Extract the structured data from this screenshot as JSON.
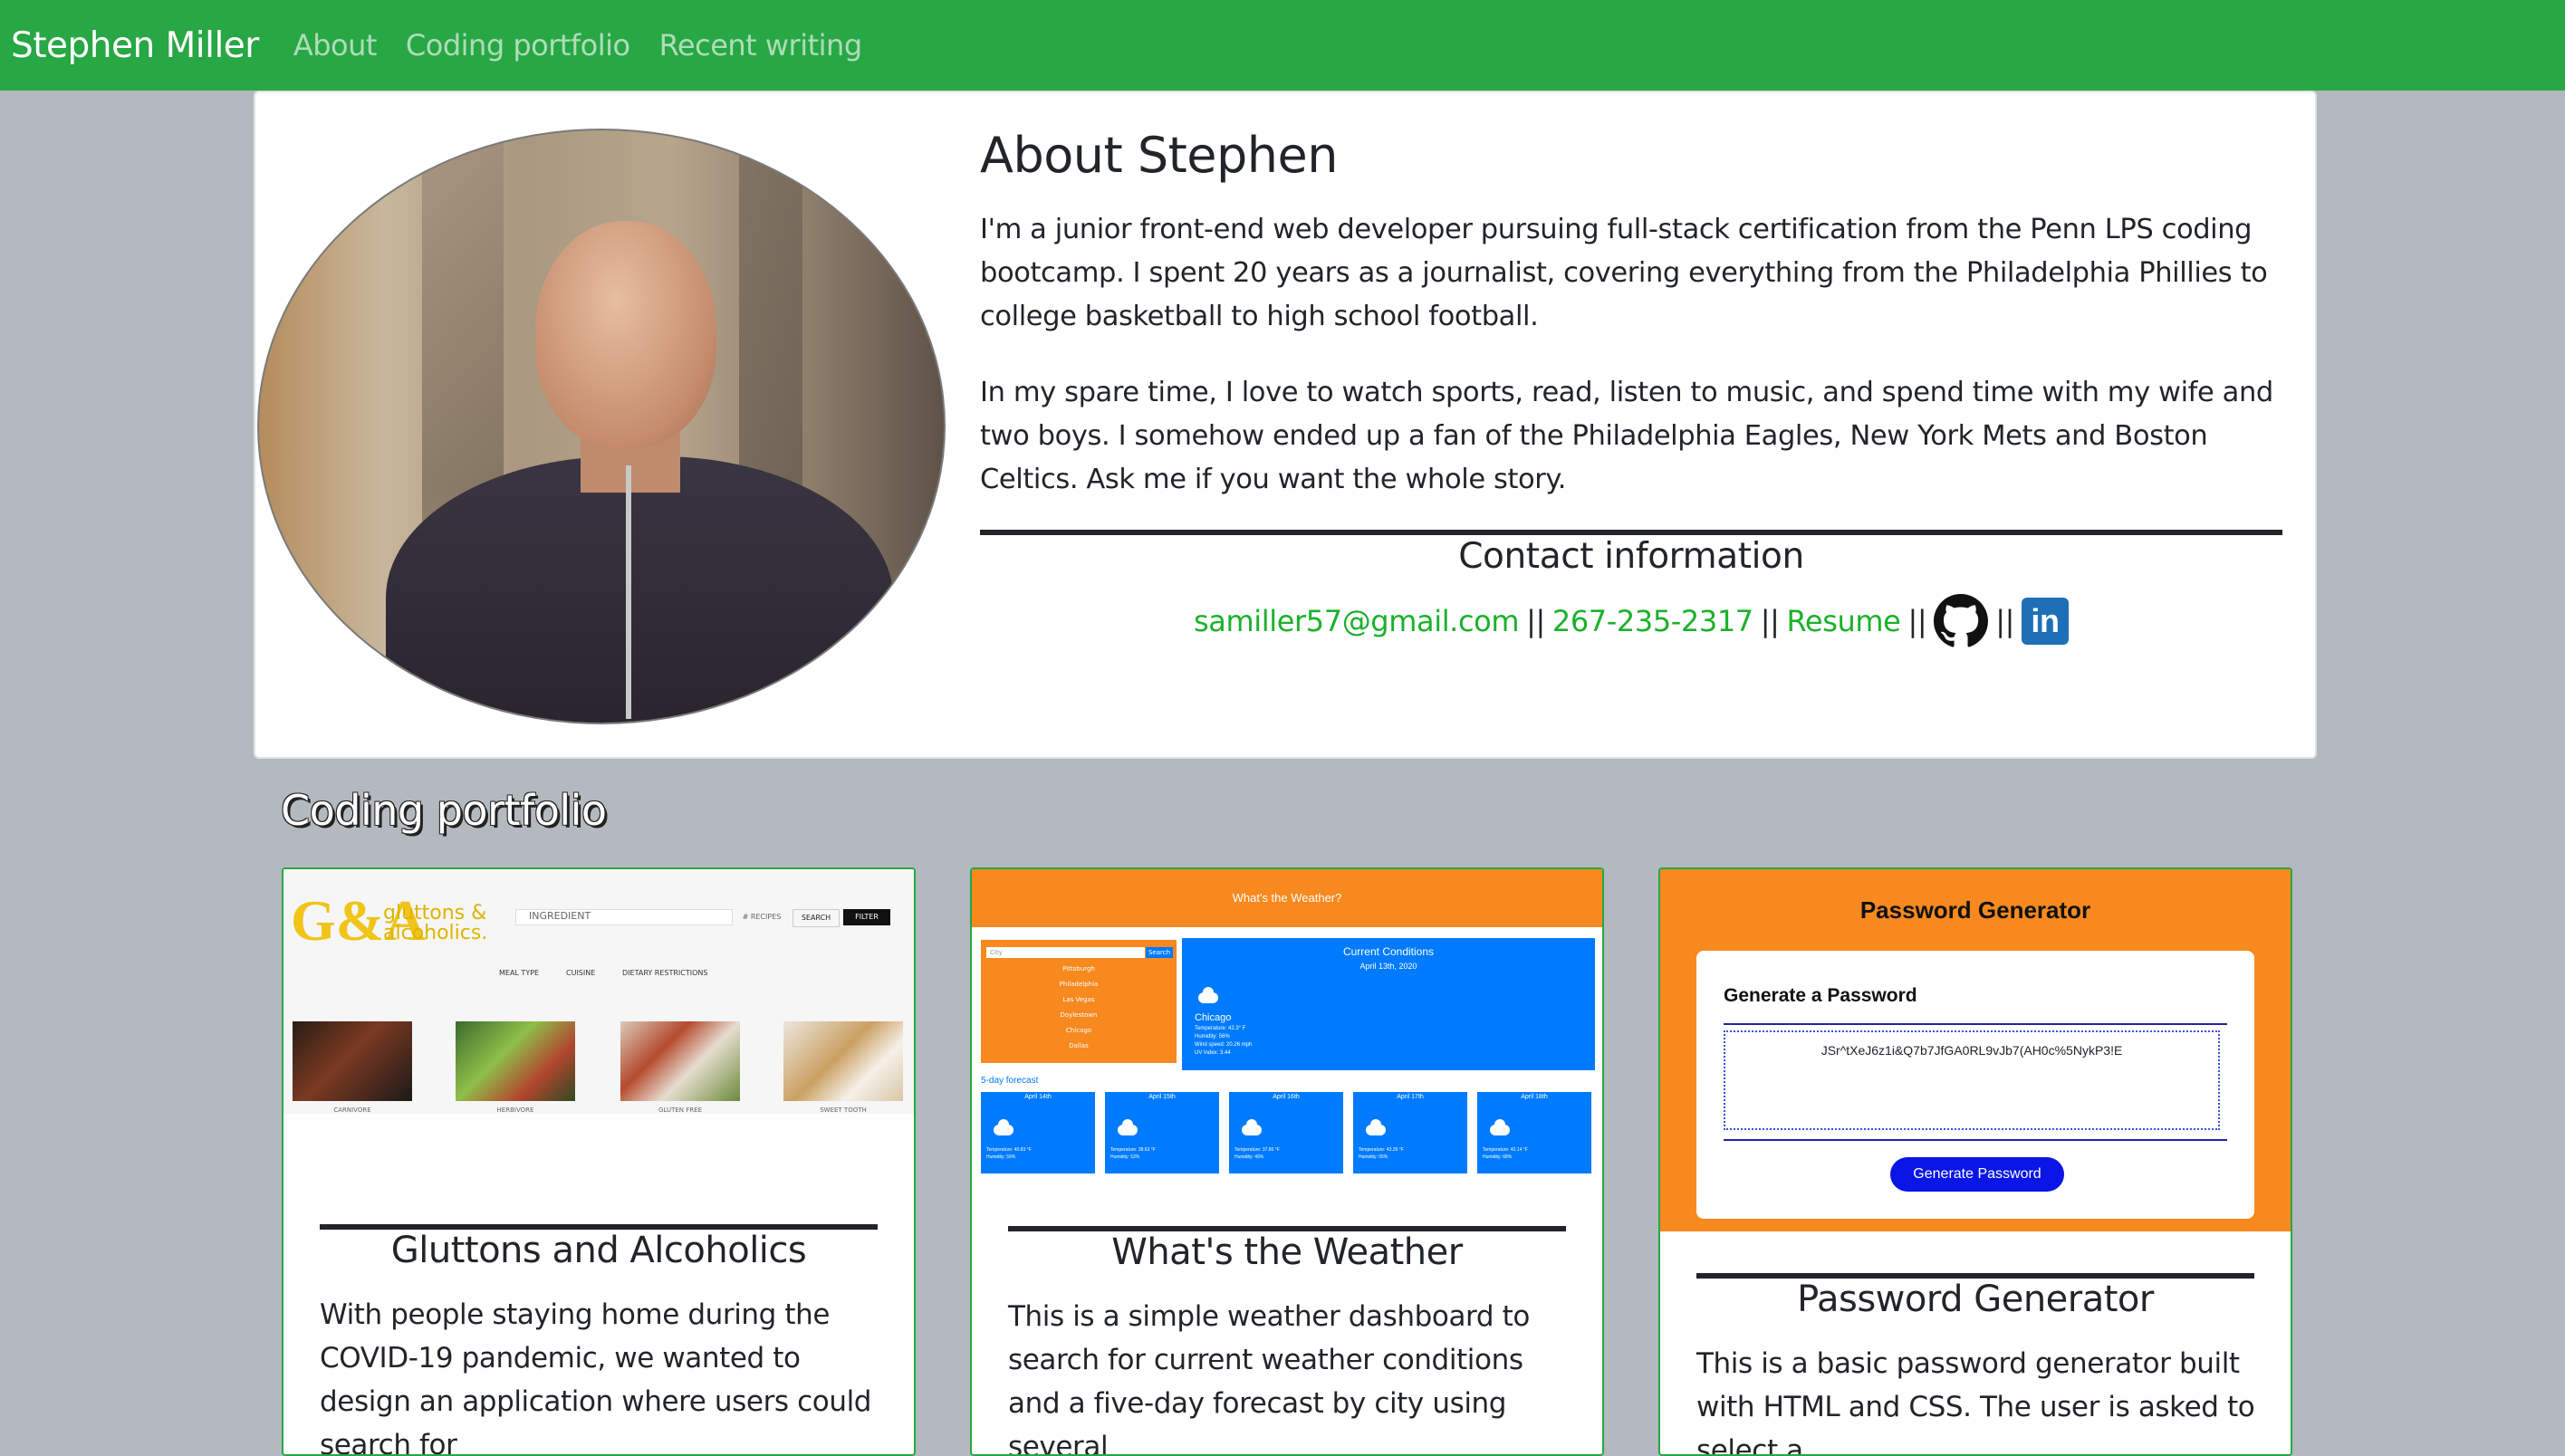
{
  "navbar": {
    "brand": "Stephen Miller",
    "links": [
      "About",
      "Coding portfolio",
      "Recent writing"
    ],
    "bg_color": "#28a745"
  },
  "about": {
    "title": "About Stephen",
    "p1": "I'm a junior front-end web developer pursuing full-stack certification from the Penn LPS coding bootcamp. I spent 20 years as a journalist, covering everything from the Philadelphia Phillies to college basketball to high school football.",
    "p2": "In my spare time, I love to watch sports, read, listen to music, and spend time with my wife and two boys. I somehow ended up a fan of the Philadelphia Eagles, New York Mets and Boston Celtics. Ask me if you want the whole story.",
    "contact_title": "Contact information",
    "email": "samiller57@gmail.com",
    "phone": "267-235-2317",
    "resume": "Resume",
    "separator": "||",
    "icons": [
      "github-icon",
      "linkedin-icon"
    ],
    "link_color": "#1bb12b"
  },
  "portfolio": {
    "heading": "Coding portfolio",
    "projects": [
      {
        "title": "Gluttons and Alcoholics",
        "desc": "With people staying home during the COVID-19 pandemic, we wanted to design an application where users could search for",
        "shot": {
          "logo": "G&A",
          "logo_text_1": "gluttons &",
          "logo_text_2": "alcoholics.",
          "search_placeholder": "INGREDIENT",
          "recipes": "# RECIPES",
          "search_btn": "SEARCH",
          "filter_btn": "FILTER",
          "menus": [
            "MEAL TYPE",
            "CUISINE",
            "DIETARY RESTRICTIONS"
          ],
          "captions": [
            "CARNIVORE",
            "HERBIVORE",
            "GLUTEN FREE",
            "SWEET TOOTH"
          ]
        }
      },
      {
        "title": "What's the Weather",
        "desc": "This is a simple weather dashboard to search for current weather conditions and a five-day forecast by city using several",
        "shot": {
          "header": "What's the Weather?",
          "input_placeholder": "City",
          "search_btn": "Search",
          "cities": [
            "Pittsburgh",
            "Philadelphia",
            "Las Vegas",
            "Doylestown",
            "Chicago",
            "Dallas"
          ],
          "current_title": "Current Conditions",
          "current_date": "April 13th, 2020",
          "current_city": "Chicago",
          "current_lines": [
            "Temperature: 42.3° F",
            "Humidity: 56%",
            "Wind speed: 20.26 mph",
            "UV Index: 3.44"
          ],
          "forecast_label": "5-day forecast",
          "forecast": [
            {
              "date": "April 14th",
              "temp": "Temperature: 40.83 °F",
              "hum": "Humidity: 59%"
            },
            {
              "date": "April 15th",
              "temp": "Temperature: 38.63 °F",
              "hum": "Humidity: 53%"
            },
            {
              "date": "April 16th",
              "temp": "Temperature: 37.86 °F",
              "hum": "Humidity: 49%"
            },
            {
              "date": "April 17th",
              "temp": "Temperature: 43.35 °F",
              "hum": "Humidity: 55%"
            },
            {
              "date": "April 18th",
              "temp": "Temperature: 42.14 °F",
              "hum": "Humidity: 68%"
            }
          ]
        }
      },
      {
        "title": "Password Generator",
        "desc": "This is a basic password generator built with HTML and CSS. The user is asked to select a",
        "shot": {
          "header": "Password Generator",
          "card_title": "Generate a Password",
          "password": "JSr^tXeJ6z1i&Q7b7JfGA0RL9vJb7(AH0c%5NykP3!E",
          "button": "Generate Password"
        }
      }
    ]
  }
}
